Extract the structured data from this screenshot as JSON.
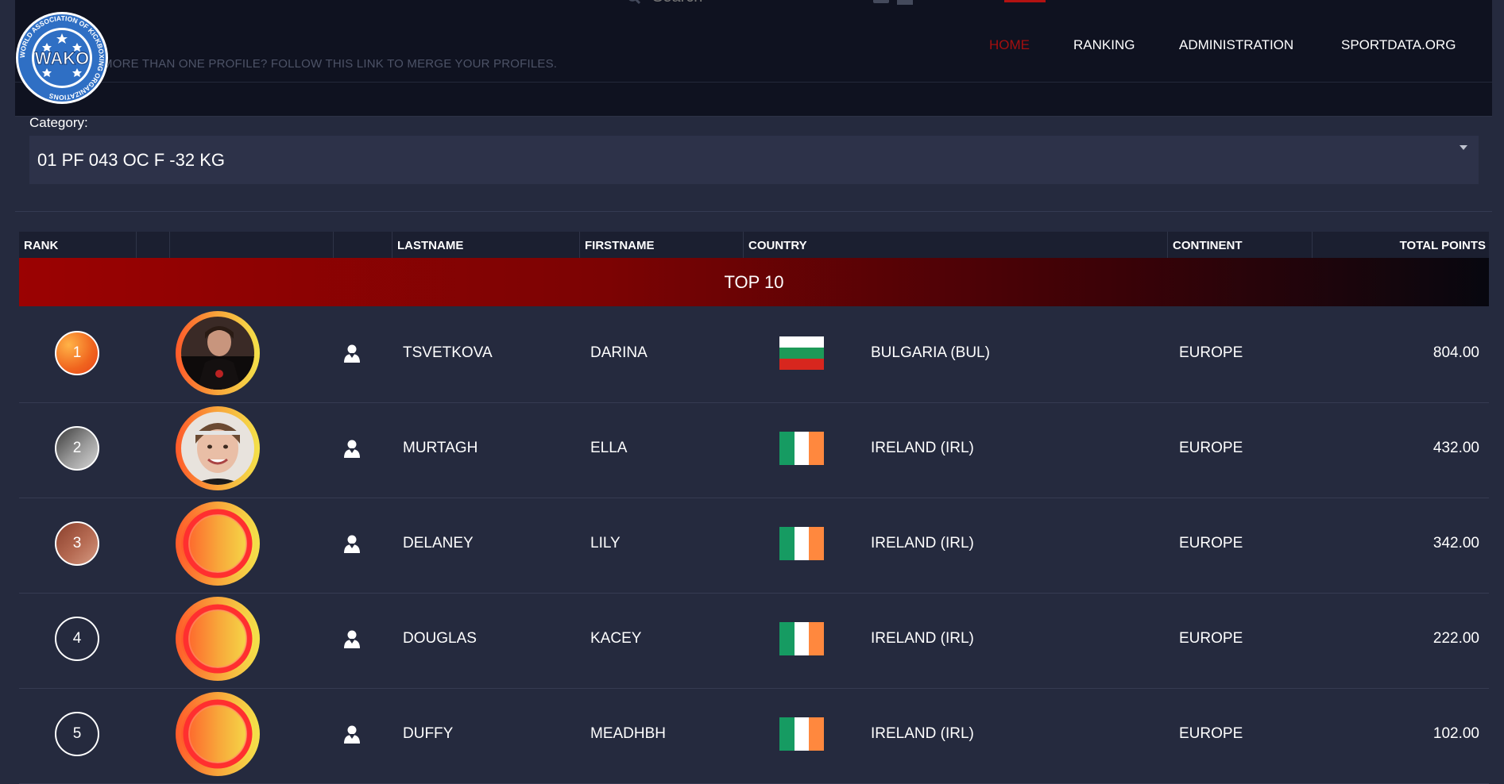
{
  "header": {
    "search_placeholder": "Search",
    "merge_link": "MORE THAN ONE PROFILE? FOLLOW THIS LINK TO MERGE YOUR PROFILES.",
    "logo_text": "WAKO",
    "logo_ring_text": "WORLD ASSOCIATION OF KICKBOXING ORGANIZATIONS",
    "nav": [
      {
        "label": "HOME",
        "active": true
      },
      {
        "label": "RANKING",
        "active": false
      },
      {
        "label": "ADMINISTRATION",
        "active": false
      },
      {
        "label": "SPORTDATA.ORG",
        "active": false
      }
    ]
  },
  "category": {
    "label": "Category:",
    "selected": "01 PF 043 OC F -32 KG"
  },
  "table": {
    "headers": {
      "rank": "RANK",
      "lastname": "LASTNAME",
      "firstname": "FIRSTNAME",
      "country": "COUNTRY",
      "continent": "CONTINENT",
      "total_points": "TOTAL POINTS"
    },
    "group_title": "TOP 10",
    "rows": [
      {
        "rank": "1",
        "lastname": "TSVETKOVA",
        "firstname": "DARINA",
        "country": "BULGARIA (BUL)",
        "flag": "bulgaria",
        "continent": "EUROPE",
        "points": "804.00"
      },
      {
        "rank": "2",
        "lastname": "MURTAGH",
        "firstname": "ELLA",
        "country": "IRELAND (IRL)",
        "flag": "ireland",
        "continent": "EUROPE",
        "points": "432.00"
      },
      {
        "rank": "3",
        "lastname": "DELANEY",
        "firstname": "LILY",
        "country": "IRELAND (IRL)",
        "flag": "ireland",
        "continent": "EUROPE",
        "points": "342.00"
      },
      {
        "rank": "4",
        "lastname": "DOUGLAS",
        "firstname": "KACEY",
        "country": "IRELAND (IRL)",
        "flag": "ireland",
        "continent": "EUROPE",
        "points": "222.00"
      },
      {
        "rank": "5",
        "lastname": "DUFFY",
        "firstname": "MEADHBH",
        "country": "IRELAND (IRL)",
        "flag": "ireland",
        "continent": "EUROPE",
        "points": "102.00"
      }
    ]
  },
  "colors": {
    "background": "#252a3e",
    "header": "#0f1220",
    "accent_red": "#a30f0f",
    "gold": "#f36b2a",
    "silver": "#8a8a8a",
    "bronze": "#a0583e"
  }
}
